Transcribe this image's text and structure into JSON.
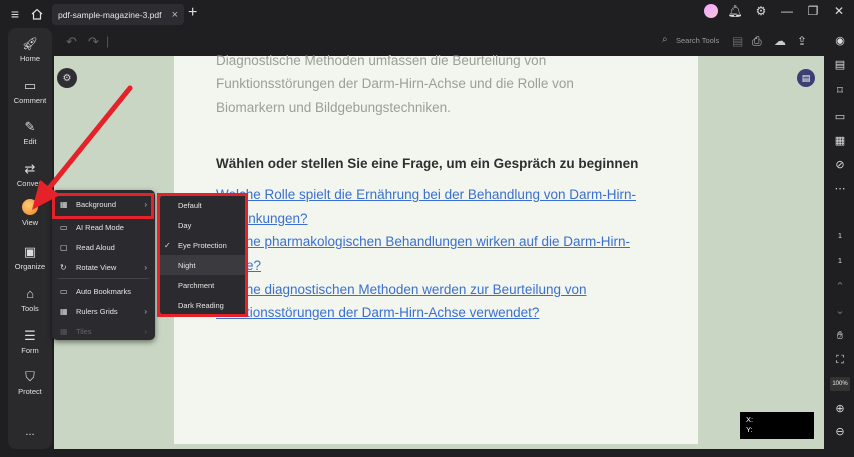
{
  "window": {
    "tab_title": "pdf-sample-magazine-3.pdf"
  },
  "sidebar": {
    "items": [
      {
        "label": "Home",
        "icon": "rocket-icon"
      },
      {
        "label": "Comment",
        "icon": "comment-icon"
      },
      {
        "label": "Edit",
        "icon": "edit-icon"
      },
      {
        "label": "Convert",
        "icon": "convert-icon"
      },
      {
        "label": "View",
        "icon": "view-icon"
      },
      {
        "label": "Organize",
        "icon": "organize-icon"
      },
      {
        "label": "Tools",
        "icon": "tools-icon"
      },
      {
        "label": "Form",
        "icon": "form-icon"
      },
      {
        "label": "Protect",
        "icon": "protect-icon"
      }
    ],
    "more": "..."
  },
  "toolbar": {
    "search_tools": "Search Tools"
  },
  "document": {
    "lines": [
      "Diagnostische Methoden umfassen die Beurteilung von",
      "Funktionsstörungen der Darm-Hirn-Achse und die Rolle von",
      "Biomarkern und Bildgebungstechniken."
    ],
    "heading": "Wählen oder stellen Sie eine Frage, um ein Gespräch zu beginnen",
    "links": [
      "Welche Rolle spielt die Ernährung bei der Behandlung von Darm-Hirn-",
      "Erkrankungen?",
      "Welche pharmakologischen Behandlungen wirken auf die Darm-Hirn-",
      "Achse?",
      "Welche diagnostischen Methoden werden zur Beurteilung von",
      "Funktionsstörungen der Darm-Hirn-Achse verwendet?"
    ]
  },
  "view_menu": {
    "items": [
      {
        "label": "Background",
        "has_submenu": true
      },
      {
        "label": "AI Read Mode",
        "has_submenu": false
      },
      {
        "label": "Read Aloud",
        "has_submenu": false
      },
      {
        "label": "Rotate View",
        "has_submenu": true
      },
      {
        "label": "Auto Bookmarks",
        "has_submenu": false
      },
      {
        "label": "Rulers  Grids",
        "has_submenu": true
      },
      {
        "label": "Tiles",
        "has_submenu": true,
        "disabled": true
      }
    ]
  },
  "background_menu": {
    "items": [
      "Default",
      "Day",
      "Eye Protection",
      "Night",
      "Parchment",
      "Dark Reading"
    ],
    "selected": "Eye Protection"
  },
  "coords": {
    "x_label": "X:",
    "y_label": "Y:"
  },
  "right_rail": {
    "page_current": "1",
    "page_total": "1",
    "zoom": "100%"
  },
  "colors": {
    "highlight": "#e5212a",
    "canvas_bg": "#c9d6c4",
    "link": "#3a6fd0"
  }
}
